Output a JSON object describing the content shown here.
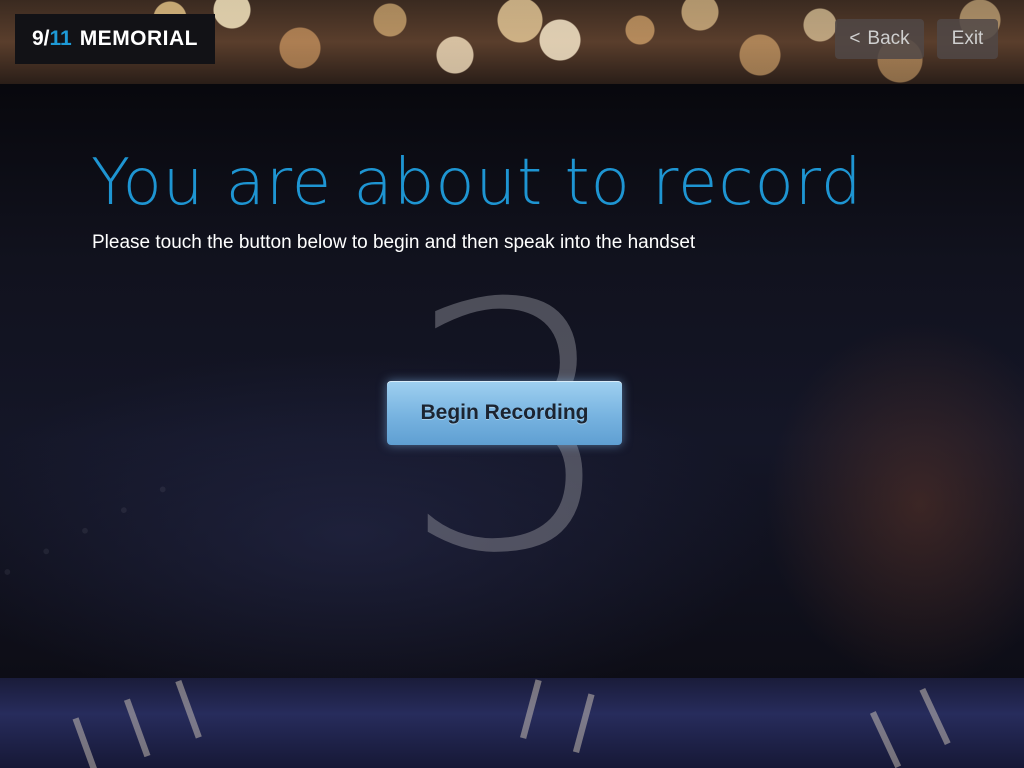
{
  "header": {
    "logo": {
      "nine": "9/",
      "eleven": "11",
      "word": "MEMORIAL"
    },
    "back_label": "Back",
    "back_icon": "chevron-left-icon",
    "exit_label": "Exit"
  },
  "main": {
    "title": "You are about to record",
    "subtitle": "Please touch the button below to begin and then speak into the handset",
    "countdown": "3",
    "record_button_label": "Begin Recording"
  },
  "colors": {
    "accent": "#1e95d2",
    "button": "#77b3e0"
  }
}
